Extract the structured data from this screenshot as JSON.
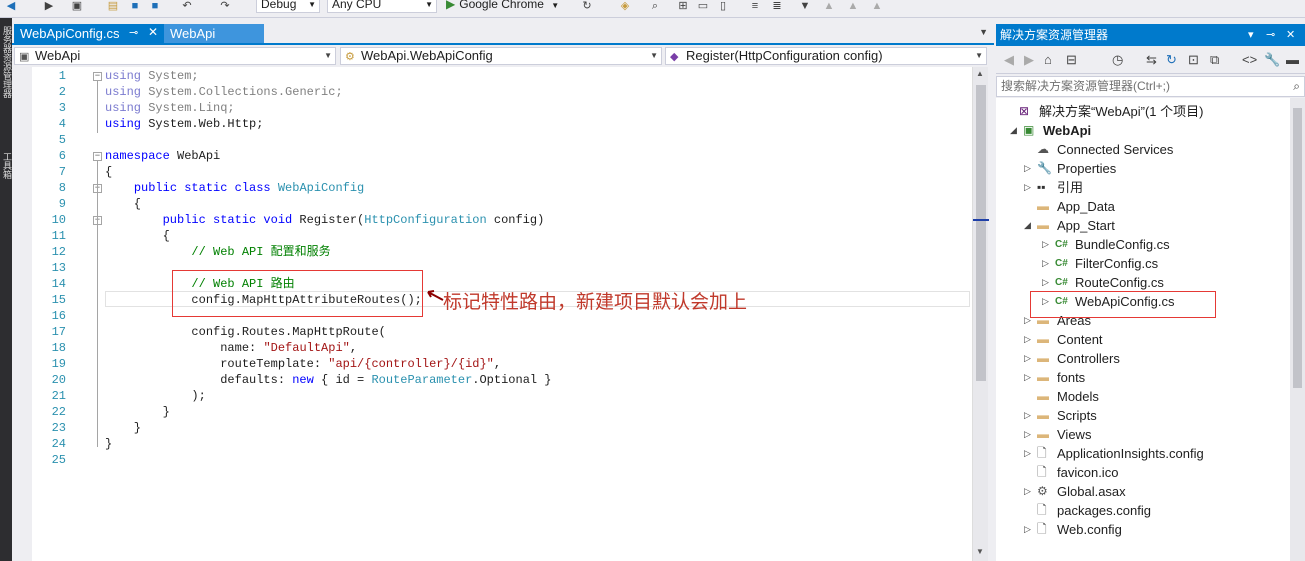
{
  "toolbar": {
    "config": "Debug",
    "platform": "Any CPU",
    "run_target": "Google Chrome"
  },
  "leftstrip": {
    "items": [
      "服务器资源管理器",
      "工具箱"
    ]
  },
  "tabs": [
    {
      "label": "WebApiConfig.cs",
      "active": true
    },
    {
      "label": "WebApi",
      "active": false
    }
  ],
  "navbar": {
    "project": "WebApi",
    "type": "WebApi.WebApiConfig",
    "member": "Register(HttpConfiguration config)"
  },
  "code": {
    "lines": [
      {
        "n": "1",
        "parts": [
          [
            "kwd",
            "using"
          ],
          [
            "dim",
            " System;"
          ]
        ]
      },
      {
        "n": "2",
        "parts": [
          [
            "kwd",
            "using"
          ],
          [
            "dim",
            " System.Collections.Generic;"
          ]
        ]
      },
      {
        "n": "3",
        "parts": [
          [
            "kwd",
            "using"
          ],
          [
            "dim",
            " System.Linq;"
          ]
        ]
      },
      {
        "n": "4",
        "parts": [
          [
            "kw",
            "using"
          ],
          [
            "plain",
            " System.Web.Http;"
          ]
        ]
      },
      {
        "n": "5",
        "parts": []
      },
      {
        "n": "6",
        "parts": [
          [
            "kw",
            "namespace"
          ],
          [
            "plain",
            " WebApi"
          ]
        ]
      },
      {
        "n": "7",
        "parts": [
          [
            "plain",
            "{"
          ]
        ]
      },
      {
        "n": "8",
        "parts": [
          [
            "plain",
            "    "
          ],
          [
            "kw",
            "public static class"
          ],
          [
            "plain",
            " "
          ],
          [
            "type",
            "WebApiConfig"
          ]
        ]
      },
      {
        "n": "9",
        "parts": [
          [
            "plain",
            "    {"
          ]
        ]
      },
      {
        "n": "10",
        "parts": [
          [
            "plain",
            "        "
          ],
          [
            "kw",
            "public static void"
          ],
          [
            "plain",
            " Register("
          ],
          [
            "type",
            "HttpConfiguration"
          ],
          [
            "plain",
            " config)"
          ]
        ]
      },
      {
        "n": "11",
        "parts": [
          [
            "plain",
            "        {"
          ]
        ]
      },
      {
        "n": "12",
        "parts": [
          [
            "cm",
            "            // Web API 配置和服务"
          ]
        ]
      },
      {
        "n": "13",
        "parts": []
      },
      {
        "n": "14",
        "parts": [
          [
            "cm",
            "            // Web API 路由"
          ]
        ]
      },
      {
        "n": "15",
        "parts": [
          [
            "plain",
            "            config.MapHttpAttributeRoutes();"
          ]
        ]
      },
      {
        "n": "16",
        "parts": []
      },
      {
        "n": "17",
        "parts": [
          [
            "plain",
            "            config.Routes.MapHttpRoute("
          ]
        ]
      },
      {
        "n": "18",
        "parts": [
          [
            "plain",
            "                name: "
          ],
          [
            "str",
            "\"DefaultApi\""
          ],
          [
            "plain",
            ","
          ]
        ]
      },
      {
        "n": "19",
        "parts": [
          [
            "plain",
            "                routeTemplate: "
          ],
          [
            "str",
            "\"api/{controller}/{id}\""
          ],
          [
            "plain",
            ","
          ]
        ]
      },
      {
        "n": "20",
        "parts": [
          [
            "plain",
            "                defaults: "
          ],
          [
            "kw",
            "new"
          ],
          [
            "plain",
            " { id = "
          ],
          [
            "type",
            "RouteParameter"
          ],
          [
            "plain",
            ".Optional }"
          ]
        ]
      },
      {
        "n": "21",
        "parts": [
          [
            "plain",
            "            );"
          ]
        ]
      },
      {
        "n": "22",
        "parts": [
          [
            "plain",
            "        }"
          ]
        ]
      },
      {
        "n": "23",
        "parts": [
          [
            "plain",
            "    }"
          ]
        ]
      },
      {
        "n": "24",
        "parts": [
          [
            "plain",
            "}"
          ]
        ]
      },
      {
        "n": "25",
        "parts": []
      }
    ]
  },
  "annotation": {
    "text": "标记特性路由，新建项目默认会加上"
  },
  "solution_explorer": {
    "title": "解决方案资源管理器",
    "search_placeholder": "搜索解决方案资源管理器(Ctrl+;)",
    "tree": [
      {
        "label": "解决方案“WebApi”(1 个项目)",
        "icon": "solution-icon",
        "depth": 0,
        "exp": ""
      },
      {
        "label": "WebApi",
        "icon": "project-icon",
        "depth": 1,
        "exp": "open",
        "bold": true
      },
      {
        "label": "Connected Services",
        "icon": "connected-services-icon",
        "depth": 2,
        "exp": ""
      },
      {
        "label": "Properties",
        "icon": "wrench-icon",
        "depth": 2,
        "exp": "closed"
      },
      {
        "label": "引用",
        "icon": "references-icon",
        "depth": 2,
        "exp": "closed"
      },
      {
        "label": "App_Data",
        "icon": "folder-icon",
        "depth": 2,
        "exp": ""
      },
      {
        "label": "App_Start",
        "icon": "folder-icon",
        "depth": 2,
        "exp": "open"
      },
      {
        "label": "BundleConfig.cs",
        "icon": "csharp-file-icon",
        "depth": 3,
        "exp": "closed"
      },
      {
        "label": "FilterConfig.cs",
        "icon": "csharp-file-icon",
        "depth": 3,
        "exp": "closed"
      },
      {
        "label": "RouteConfig.cs",
        "icon": "csharp-file-icon",
        "depth": 3,
        "exp": "closed"
      },
      {
        "label": "WebApiConfig.cs",
        "icon": "csharp-file-icon",
        "depth": 3,
        "exp": "closed"
      },
      {
        "label": "Areas",
        "icon": "folder-icon",
        "depth": 2,
        "exp": "closed"
      },
      {
        "label": "Content",
        "icon": "folder-icon",
        "depth": 2,
        "exp": "closed"
      },
      {
        "label": "Controllers",
        "icon": "folder-icon",
        "depth": 2,
        "exp": "closed"
      },
      {
        "label": "fonts",
        "icon": "folder-icon",
        "depth": 2,
        "exp": "closed"
      },
      {
        "label": "Models",
        "icon": "folder-icon",
        "depth": 2,
        "exp": ""
      },
      {
        "label": "Scripts",
        "icon": "folder-icon",
        "depth": 2,
        "exp": "closed"
      },
      {
        "label": "Views",
        "icon": "folder-icon",
        "depth": 2,
        "exp": "closed"
      },
      {
        "label": "ApplicationInsights.config",
        "icon": "config-file-icon",
        "depth": 2,
        "exp": "closed"
      },
      {
        "label": "favicon.ico",
        "icon": "ico-file-icon",
        "depth": 2,
        "exp": ""
      },
      {
        "label": "Global.asax",
        "icon": "asax-file-icon",
        "depth": 2,
        "exp": "closed"
      },
      {
        "label": "packages.config",
        "icon": "config-file-icon",
        "depth": 2,
        "exp": ""
      },
      {
        "label": "Web.config",
        "icon": "config-file-icon",
        "depth": 2,
        "exp": "closed"
      }
    ]
  }
}
